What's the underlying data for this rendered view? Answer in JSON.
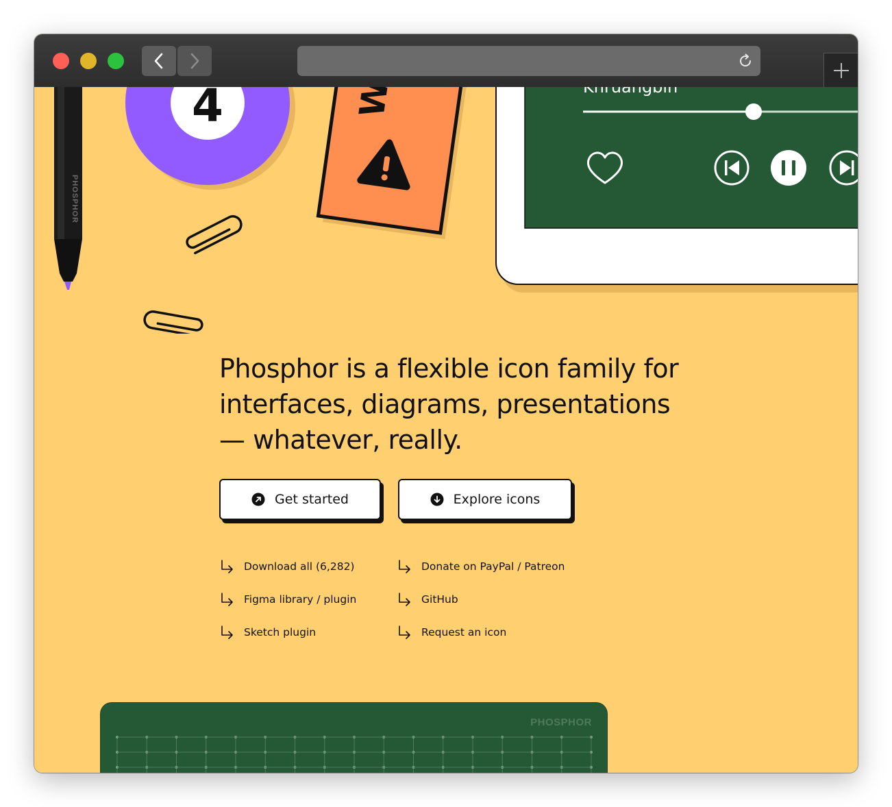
{
  "browser": {
    "url": "",
    "colors": {
      "titlebar": "#2d2d2d",
      "close": "#fe5f57",
      "minimize": "#e0b52a",
      "maximize": "#2cc13e"
    }
  },
  "illustration": {
    "ball_number": "4",
    "pen_brand": "PHOSPHOR",
    "card_letter": "W",
    "player_artist": "Khruangbin",
    "player_progress": 0.6,
    "board_brand": "PHOSPHOR"
  },
  "hero": {
    "tagline": "Phosphor is a flexible icon family for interfaces, diagrams, presentations — whatever, really."
  },
  "buttons": {
    "get_started": "Get started",
    "explore_icons": "Explore icons"
  },
  "links": {
    "download_all": "Download all (6,282)",
    "figma": "Figma library / plugin",
    "sketch": "Sketch plugin",
    "donate": "Donate on PayPal / Patreon",
    "github": "GitHub",
    "request": "Request an icon"
  },
  "colors": {
    "background": "#ffcf70",
    "ball": "#925bff",
    "card": "#ff8e51",
    "tablet_screen": "#255835",
    "ink": "#111111"
  }
}
